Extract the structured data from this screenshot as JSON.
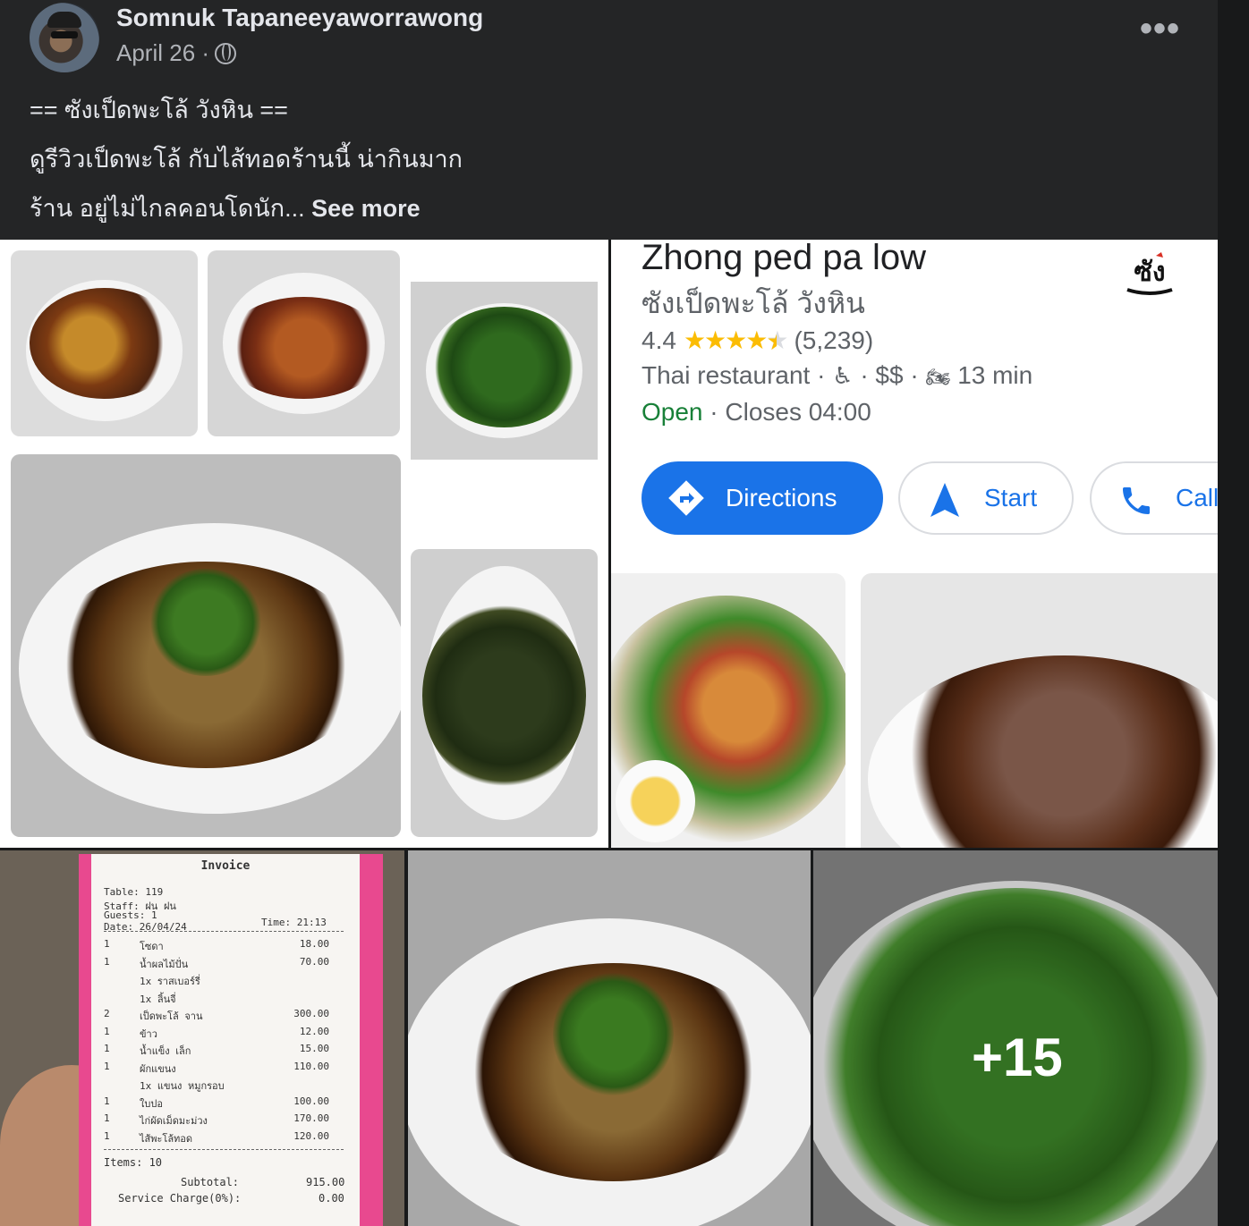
{
  "post": {
    "author": "Somnuk Tapaneeyaworrawong",
    "date": "April 26 ·",
    "privacy_icon": "globe-icon",
    "more_label": "•••",
    "lines": [
      "== ซังเป็ดพะโล้ วังหิน ==",
      "ดูรีวิวเป็ดพะโล้ กับไส้ทอดร้านนี้ น่ากินมาก",
      "ร้าน อยู่ไม่ไกลคอนโดนัก..."
    ],
    "see_more": "See more"
  },
  "maps": {
    "title": "Zhong ped pa low",
    "subtitle": "ซังเป็ดพะโล้ วังหิน",
    "rating": "4.4",
    "stars_value": 4.4,
    "reviews": "(5,239)",
    "category": "Thai restaurant",
    "price": "$$",
    "travel": "13 min",
    "open": "Open",
    "closes": "Closes 04:00",
    "buttons": {
      "directions": "Directions",
      "start": "Start",
      "call": "Call"
    }
  },
  "receipt": {
    "title": "Invoice",
    "table": "Table:  119",
    "staff": "Staff:  ฝน ฝน",
    "guests": "Guests:  1",
    "date": "Date:  26/04/24",
    "time": "Time:  21:13",
    "items": [
      {
        "qty": "1",
        "name": "โซดา",
        "price": "18.00"
      },
      {
        "qty": "1",
        "name": "น้ำผลไม้ปั่น",
        "price": "70.00"
      },
      {
        "qty": "",
        "name": "1x ราสเบอร์รี่",
        "price": ""
      },
      {
        "qty": "",
        "name": "1x ลิ้นจี่",
        "price": ""
      },
      {
        "qty": "2",
        "name": "เป็ดพะโล้ จาน",
        "price": "300.00"
      },
      {
        "qty": "1",
        "name": "ข้าว",
        "price": "12.00"
      },
      {
        "qty": "1",
        "name": "น้ำแข็ง เล็ก",
        "price": "15.00"
      },
      {
        "qty": "1",
        "name": "ผักแขนง",
        "price": "110.00"
      },
      {
        "qty": "",
        "name": "1x แขนง หมูกรอบ",
        "price": ""
      },
      {
        "qty": "1",
        "name": "ใบปอ",
        "price": "100.00"
      },
      {
        "qty": "1",
        "name": "ไก่ผัดเม็ดมะม่วง",
        "price": "170.00"
      },
      {
        "qty": "1",
        "name": "ไส้พะโล้ทอด",
        "price": "120.00"
      }
    ],
    "items_count": "Items:  10",
    "subtotal_label": "Subtotal:",
    "subtotal": "915.00",
    "service_label": "Service Charge(0%):",
    "service": "0.00"
  },
  "more_photos": "+15"
}
